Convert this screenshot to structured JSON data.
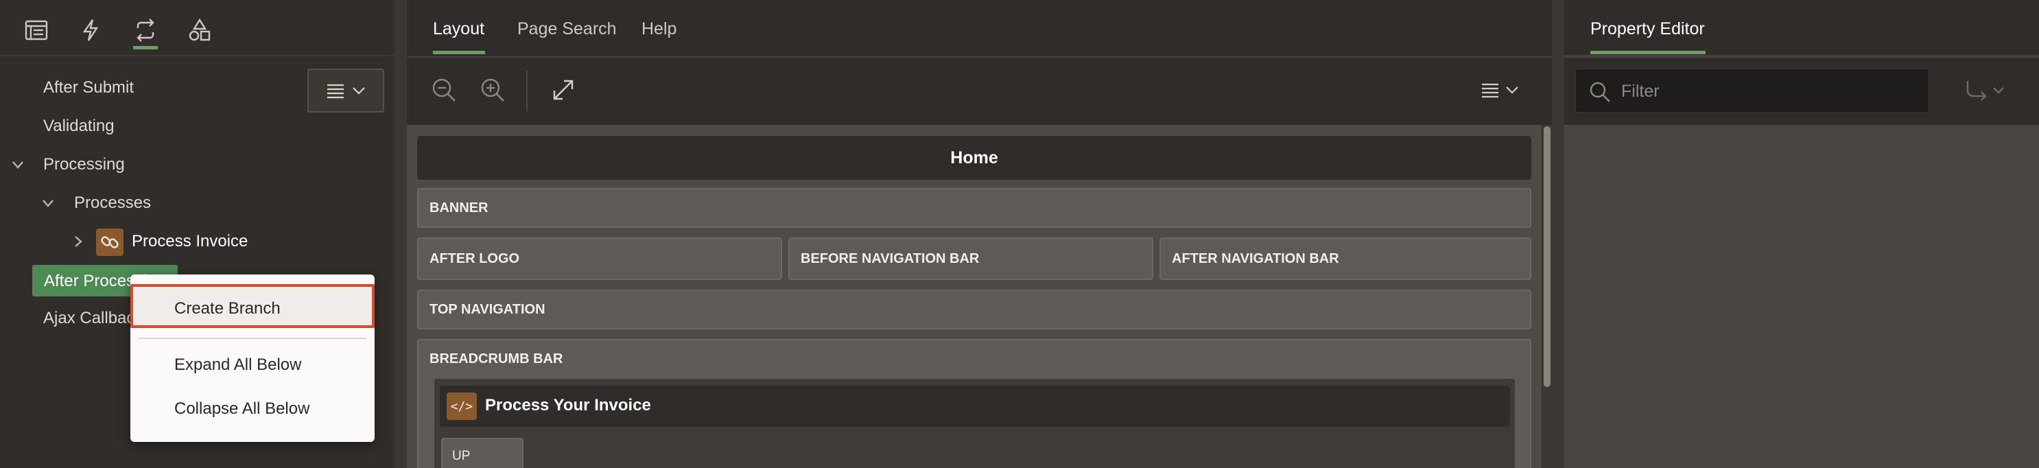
{
  "left": {
    "tabs": [
      {
        "icon": "rendering-tree-icon"
      },
      {
        "icon": "dynamic-actions-icon"
      },
      {
        "icon": "processing-icon",
        "active": true
      },
      {
        "icon": "shared-components-icon"
      }
    ],
    "tree": {
      "after_submit": "After Submit",
      "validating": "Validating",
      "processing": "Processing",
      "processes": "Processes",
      "process_invoice": "Process Invoice",
      "after_processing": "After Processing",
      "ajax_callback": "Ajax Callback"
    },
    "context_menu": {
      "create_branch": "Create Branch",
      "expand_all_below": "Expand All Below",
      "collapse_all_below": "Collapse All Below"
    }
  },
  "center": {
    "tabs": {
      "layout": "Layout",
      "page_search": "Page Search",
      "help": "Help"
    },
    "canvas": {
      "home": "Home",
      "banner": "BANNER",
      "after_logo": "AFTER LOGO",
      "before_navigation_bar": "BEFORE NAVIGATION BAR",
      "after_navigation_bar": "AFTER NAVIGATION BAR",
      "top_navigation": "TOP NAVIGATION",
      "breadcrumb_bar": "BREADCRUMB BAR",
      "process_your_invoice": "Process Your Invoice",
      "process_icon_glyph": "</>",
      "up": "UP"
    }
  },
  "right": {
    "title": "Property Editor",
    "filter_placeholder": "Filter"
  },
  "colors": {
    "accent": "#6f9b67",
    "selection": "#4e8a54",
    "highlight_border": "#d64b2e",
    "process_icon": "#8a5a2e"
  }
}
